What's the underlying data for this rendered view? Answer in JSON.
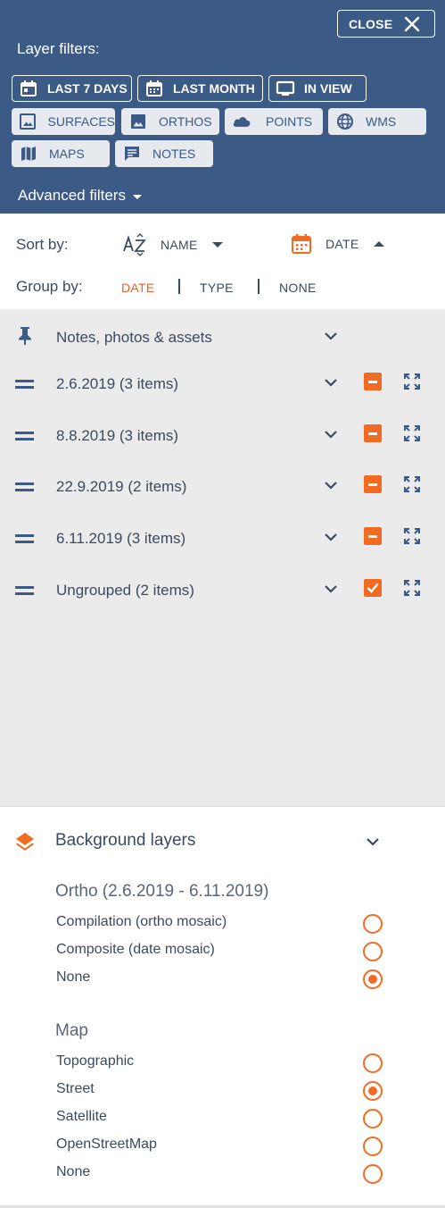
{
  "header": {
    "close_label": "CLOSE",
    "title": "Layer filters:",
    "date_chips": [
      {
        "label": "LAST 7 DAYS",
        "icon": "calendar-icon"
      },
      {
        "label": "LAST MONTH",
        "icon": "calendar-icon"
      },
      {
        "label": "IN VIEW",
        "icon": "monitor-icon"
      }
    ],
    "type_chips": [
      {
        "label": "SURFACES",
        "icon": "image-icon"
      },
      {
        "label": "ORTHOS",
        "icon": "image-icon"
      },
      {
        "label": "POINTS",
        "icon": "cloud-icon"
      },
      {
        "label": "WMS",
        "icon": "globe-icon"
      },
      {
        "label": "MAPS",
        "icon": "map-icon"
      },
      {
        "label": "NOTES",
        "icon": "comment-icon"
      }
    ],
    "advanced_label": "Advanced filters"
  },
  "sort": {
    "label": "Sort by:",
    "name_label": "NAME",
    "date_label": "DATE"
  },
  "group": {
    "label": "Group by:",
    "options": [
      "DATE",
      "TYPE",
      "NONE"
    ],
    "active": "DATE"
  },
  "layers": {
    "pinned_label": "Notes, photos & assets",
    "rows": [
      {
        "label": "2.6.2019 (3 items)",
        "state": "partial"
      },
      {
        "label": "8.8.2019 (3 items)",
        "state": "partial"
      },
      {
        "label": "22.9.2019 (2 items)",
        "state": "partial"
      },
      {
        "label": "6.11.2019 (3 items)",
        "state": "partial"
      },
      {
        "label": "Ungrouped (2 items)",
        "state": "checked"
      }
    ]
  },
  "background": {
    "title": "Background layers",
    "ortho_title": "Ortho (2.6.2019 - 6.11.2019)",
    "ortho_options": [
      {
        "label": "Compilation (ortho mosaic)",
        "selected": false
      },
      {
        "label": "Composite (date mosaic)",
        "selected": false
      },
      {
        "label": "None",
        "selected": true
      }
    ],
    "map_title": "Map",
    "map_options": [
      {
        "label": "Topographic",
        "selected": false
      },
      {
        "label": "Street",
        "selected": true
      },
      {
        "label": "Satellite",
        "selected": false
      },
      {
        "label": "OpenStreetMap",
        "selected": false
      },
      {
        "label": "None",
        "selected": false
      }
    ]
  },
  "colors": {
    "header_bg": "#3b5a85",
    "accent": "#f26b22",
    "panel_bg": "#ebebeb",
    "text": "#3b4a5e"
  }
}
